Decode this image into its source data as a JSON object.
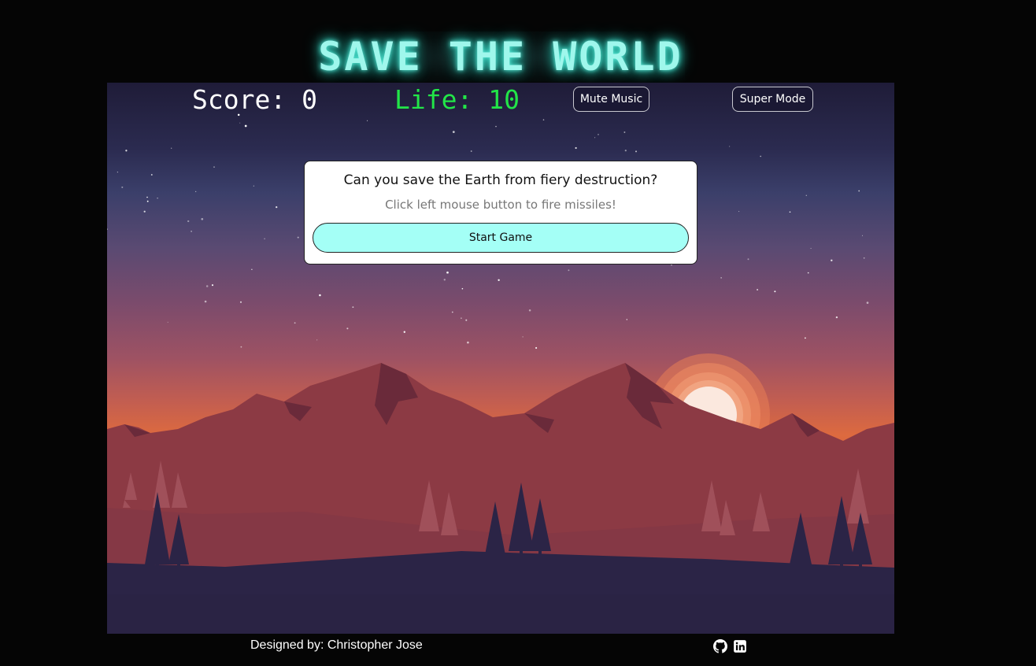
{
  "header": {
    "title": "SAVE THE WORLD"
  },
  "hud": {
    "score_label": "Score: 0",
    "life_label": "Life: 10",
    "mute_music_label": "Mute Music",
    "super_mode_label": "Super Mode"
  },
  "dialog": {
    "question": "Can you save the Earth from fiery destruction?",
    "instructions": "Click left mouse button to fire missiles!",
    "start_button_label": "Start Game"
  },
  "footer": {
    "credit": "Designed by: Christopher Jose",
    "links": [
      {
        "icon": "github-icon"
      },
      {
        "icon": "linkedin-icon"
      }
    ]
  },
  "colors": {
    "title_glow": "#9ff7ec",
    "life_text": "#22e548",
    "start_button_bg": "#a4fff6",
    "page_bg": "#050505"
  }
}
